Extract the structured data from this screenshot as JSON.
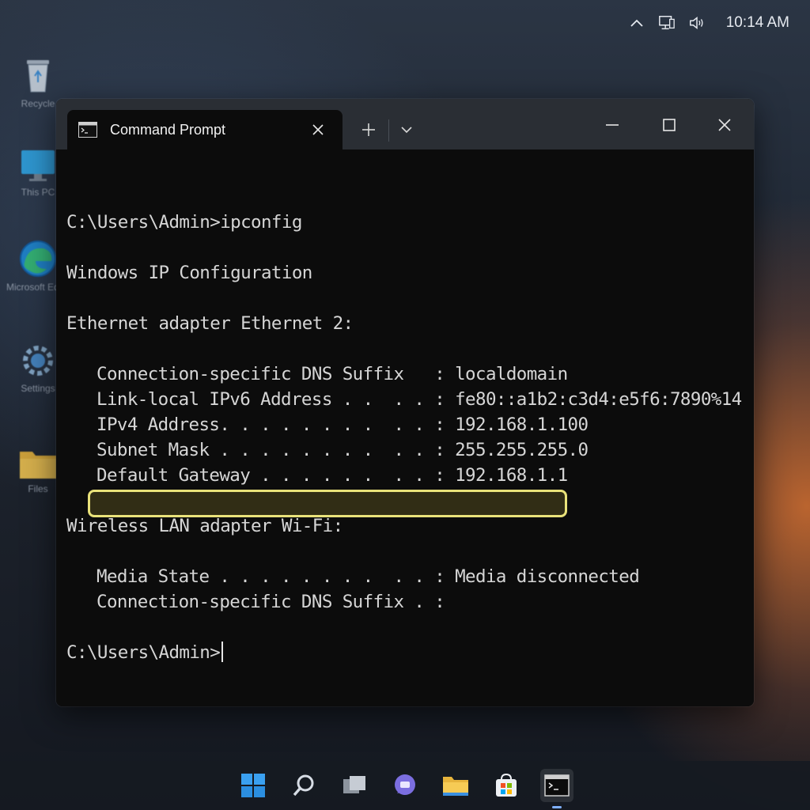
{
  "system_tray": {
    "time": "10:14 AM",
    "icons": [
      "chevron-up-icon",
      "network-icon",
      "volume-icon"
    ]
  },
  "desktop_icons": [
    {
      "label": "Recycle",
      "icon": "recycle-bin-icon"
    },
    {
      "label": "This PC",
      "icon": "monitor-icon"
    },
    {
      "label": "Microsoft Edge",
      "icon": "edge-icon"
    },
    {
      "label": "Settings",
      "icon": "gear-icon"
    },
    {
      "label": "Files",
      "icon": "folder-icon"
    }
  ],
  "window": {
    "tab_title": "Command Prompt",
    "tab_icon": "terminal-icon"
  },
  "terminal": {
    "lines": [
      "",
      "C:\\Users\\Admin>ipconfig",
      "",
      "Windows IP Configuration",
      "",
      "Ethernet adapter Ethernet 2:",
      "",
      "Connection-specific DNS Suffix   : localdomain",
      "Link-local IPv6 Address . .  . . : fe80::a1b2:c3d4:e5f6:7890%14",
      "IPv4 Address. . . . . . . .  . . : 192.168.1.100",
      "Subnet Mask . . . . . . . .  . . : 255.255.255.0",
      "Default Gateway . . . . . .  . . : 192.168.1.1",
      "",
      "Wireless LAN adapter Wi-Fi:",
      "",
      "Media State . . . . . . . .  . . : Media disconnected",
      "Connection-specific DNS Suffix . :",
      "",
      "C:\\Users\\Admin>"
    ],
    "highlighted_line": "Default Gateway . . . . . .  . . : 192.168.1.1",
    "highlight_color": "#e9e27a"
  },
  "taskbar": {
    "items": [
      "windows-start-icon",
      "search-icon",
      "task-view-icon",
      "chat-icon",
      "file-explorer-icon",
      "store-icon",
      "terminal-icon"
    ],
    "active": "terminal-icon"
  }
}
